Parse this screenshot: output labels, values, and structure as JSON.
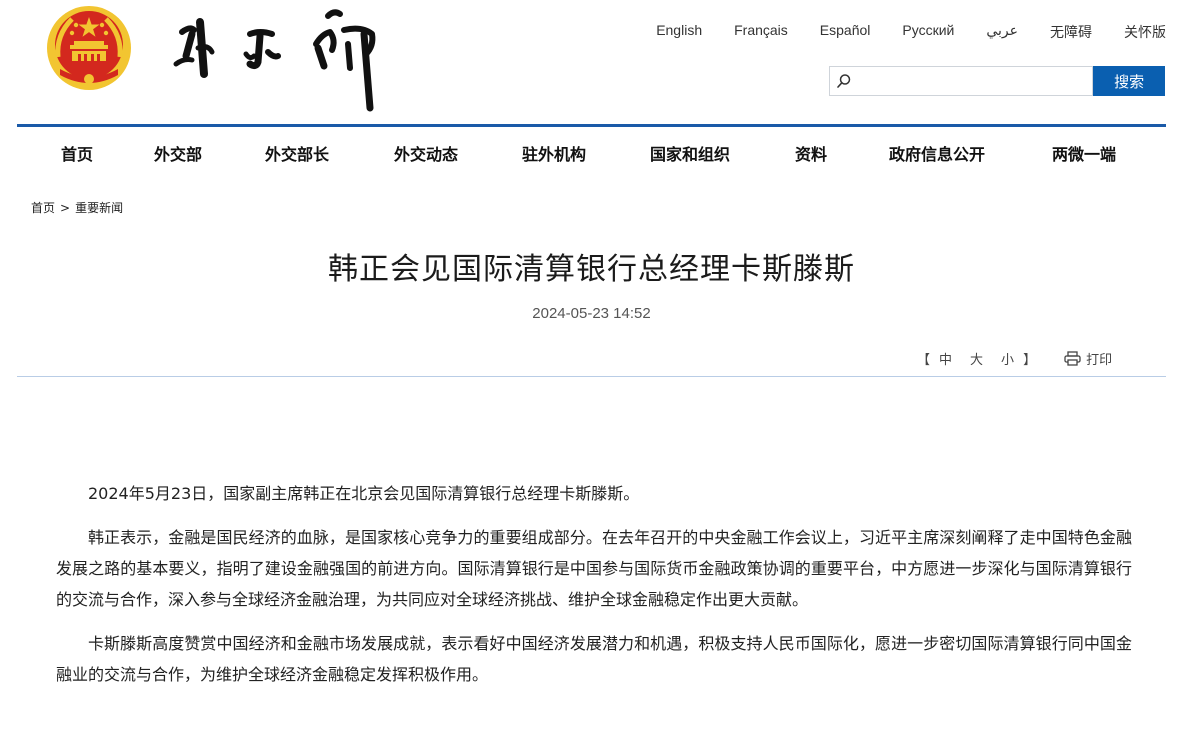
{
  "header": {
    "languages": [
      "English",
      "Français",
      "Español",
      "Русский",
      "عربي",
      "无障碍",
      "关怀版"
    ],
    "search": {
      "placeholder": "",
      "button_label": "搜索"
    }
  },
  "nav": {
    "items": [
      "首页",
      "外交部",
      "外交部长",
      "外交动态",
      "驻外机构",
      "国家和组织",
      "资料",
      "政府信息公开",
      "两微一端"
    ]
  },
  "breadcrumb": {
    "home": "首页",
    "separator": ">",
    "current": "重要新闻"
  },
  "article": {
    "title": "韩正会见国际清算银行总经理卡斯滕斯",
    "date": "2024-05-23 14:52",
    "tools": {
      "bracket_open": "【",
      "size_large": "中",
      "size_medium": "大",
      "size_small": "小",
      "bracket_close": "】",
      "print_label": "打印"
    },
    "paragraphs": [
      "2024年5月23日，国家副主席韩正在北京会见国际清算银行总经理卡斯滕斯。",
      "韩正表示，金融是国民经济的血脉，是国家核心竞争力的重要组成部分。在去年召开的中央金融工作会议上，习近平主席深刻阐释了走中国特色金融发展之路的基本要义，指明了建设金融强国的前进方向。国际清算银行是中国参与国际货币金融政策协调的重要平台，中方愿进一步深化与国际清算银行的交流与合作，深入参与全球经济金融治理，为共同应对全球经济挑战、维护全球金融稳定作出更大贡献。",
      "卡斯滕斯高度赞赏中国经济和金融市场发展成就，表示看好中国经济发展潜力和机遇，积极支持人民币国际化，愿进一步密切国际清算银行同中国金融业的交流与合作，为维护全球经济金融稳定发挥积极作用。"
    ]
  },
  "colors": {
    "brand_blue": "#1a5aa8",
    "search_button": "#0a5fb0",
    "emblem_red": "#d3281e",
    "emblem_gold": "#f2c531"
  }
}
